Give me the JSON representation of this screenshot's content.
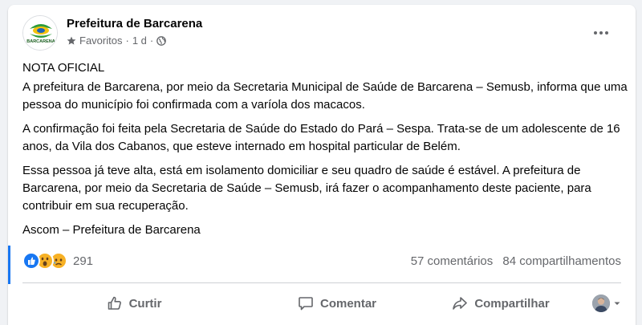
{
  "post": {
    "page_name": "Prefeitura de Barcarena",
    "avatar_label": "BARCARENA",
    "audience": "Favoritos",
    "time": "1 d",
    "paragraphs": [
      "NOTA OFICIAL",
      "A prefeitura de Barcarena, por meio da Secretaria Municipal de Saúde de Barcarena – Semusb, informa que uma pessoa do município foi confirmada com a varíola dos macacos.",
      "A confirmação foi feita pela Secretaria de Saúde do Estado do Pará – Sespa. Trata-se de um adolescente de 16 anos, da Vila dos Cabanos, que esteve internado em hospital particular de Belém.",
      "Essa pessoa já teve alta, está em isolamento domiciliar e seu quadro de saúde é estável. A prefeitura de Barcarena, por meio da Secretaria de Saúde – Semusb, irá fazer o acompanhamento deste paciente, para contribuir em sua recuperação.",
      "Ascom – Prefeitura de Barcarena"
    ]
  },
  "stats": {
    "reactions_count": "291",
    "comments": "57 comentários",
    "shares": "84 compartilhamentos"
  },
  "actions": {
    "like": "Curtir",
    "comment": "Comentar",
    "share": "Compartilhar"
  },
  "colors": {
    "like_blue": "#1877f2",
    "wow_yellow": "#f7b125",
    "muted_text": "#65676b"
  }
}
